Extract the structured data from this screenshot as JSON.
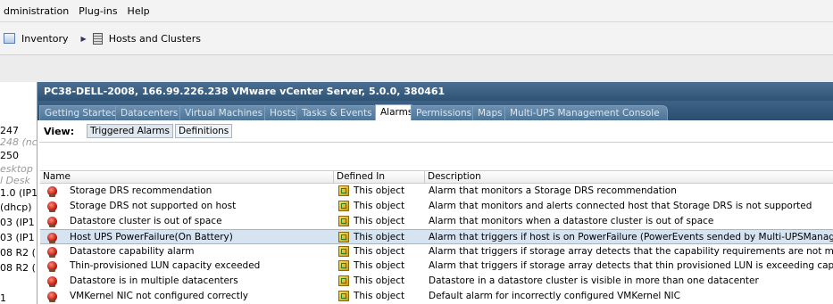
{
  "menubar": {
    "items": [
      "dministration",
      "Plug-ins",
      "Help"
    ]
  },
  "navbar": {
    "inventory_icon": "inventory-icon",
    "inventory_label": "Inventory",
    "separator_icon": "chevron-right-icon",
    "hosts_icon": "hosts-clusters-icon",
    "hosts_label": "Hosts and Clusters"
  },
  "tree": {
    "items": [
      "247",
      "248 (nc",
      "250",
      "esktop",
      "l Desk",
      "1.0 (IP1",
      "(dhcp)",
      "03 (IP1",
      "03 (IP1",
      "08 R2 (",
      "08 R2 (",
      "1"
    ]
  },
  "header": {
    "title": "PC38-DELL-2008, 166.99.226.238 VMware vCenter Server, 5.0.0, 380461"
  },
  "tabs": [
    "Getting Started",
    "Datacenters",
    "Virtual Machines",
    "Hosts",
    "Tasks & Events",
    "Alarms",
    "Permissions",
    "Maps",
    "Multi-UPS Management Console"
  ],
  "active_tab": "Alarms",
  "view": {
    "label": "View:",
    "buttons": [
      "Triggered Alarms",
      "Definitions"
    ]
  },
  "table": {
    "columns": [
      "Name",
      "Defined In",
      "Description"
    ],
    "rows": [
      {
        "name": "Storage DRS recommendation",
        "defined_in": "This object",
        "description": "Alarm that monitors a Storage DRS recommendation"
      },
      {
        "name": "Storage DRS not supported on host",
        "defined_in": "This object",
        "description": "Alarm that monitors and alerts connected host that Storage DRS is not supported"
      },
      {
        "name": "Datastore cluster is out of space",
        "defined_in": "This object",
        "description": "Alarm that monitors when a datastore cluster is out of space"
      },
      {
        "name": "Host UPS PowerFailure(On Battery)",
        "defined_in": "This object",
        "description": "Alarm that triggers if host is on PowerFailure (PowerEvents sended by Multi-UPSManagement Con"
      },
      {
        "name": "Datastore capability alarm",
        "defined_in": "This object",
        "description": "Alarm that triggers if storage array detects that the capability requirements are not met"
      },
      {
        "name": "Thin-provisioned LUN capacity exceeded",
        "defined_in": "This object",
        "description": "Alarm that triggers if storage array detects that thin provisioned LUN is exceeding capacity threshol"
      },
      {
        "name": "Datastore is in multiple datacenters",
        "defined_in": "This object",
        "description": "Datastore in a datastore cluster is visible in more than one datacenter"
      },
      {
        "name": "VMKernel NIC not configured correctly",
        "defined_in": "This object",
        "description": "Default alarm for incorrectly configured VMKernel NIC"
      }
    ],
    "selected_index": 3,
    "row_icon": "alarm-icon",
    "defined_in_icon": "object-icon"
  },
  "colors": {
    "header_bg": "#2f5375",
    "selection": "#d6e3f1",
    "alarm_red": "#c21a10"
  }
}
